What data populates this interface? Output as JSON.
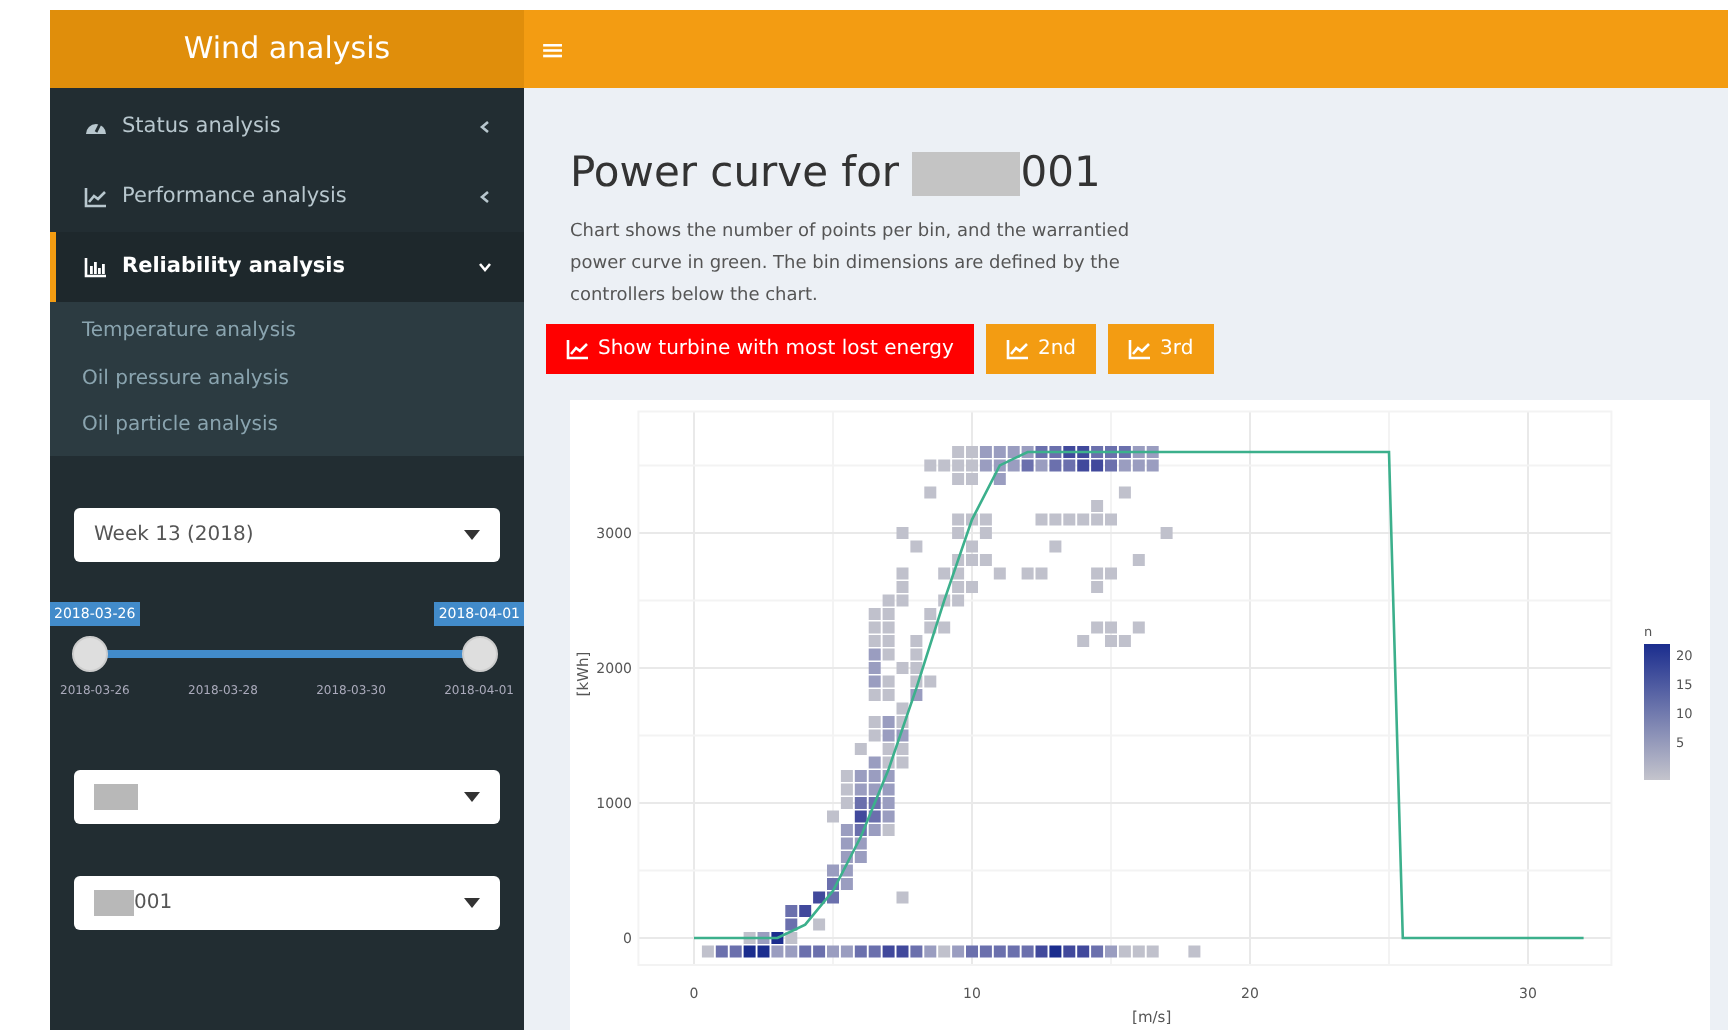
{
  "header": {
    "title": "Wind analysis",
    "menu_toggle": "≡"
  },
  "sidebar": {
    "items": [
      {
        "label": "Status analysis",
        "expanded": false,
        "selected": false
      },
      {
        "label": "Performance analysis",
        "expanded": false,
        "selected": false
      },
      {
        "label": "Reliability analysis",
        "expanded": true,
        "selected": true,
        "children": [
          {
            "label": "Temperature analysis"
          },
          {
            "label": "Oil pressure analysis"
          },
          {
            "label": "Oil particle analysis"
          }
        ]
      }
    ],
    "period_select": {
      "value": "Week 13 (2018)"
    },
    "date_slider": {
      "handles": [
        {
          "label": "2018-03-26"
        },
        {
          "label": "2018-04-01"
        }
      ],
      "ticks": [
        "2018-03-26",
        "2018-03-28",
        "2018-03-30",
        "2018-04-01"
      ]
    },
    "park_select": {
      "redacted": true
    },
    "turbine_select": {
      "redacted": true,
      "value": "001"
    }
  },
  "main": {
    "title": "Power curve for ",
    "title_redacted": true,
    "title_suffix": "001",
    "description": "Chart shows the number of points per bin, and the warrantied power curve in green. The bin dimensions are defined by the controllers below the chart.",
    "buttons": [
      {
        "label": "Show turbine with most lost energy",
        "kind": "primary"
      },
      {
        "label": "2nd",
        "kind": "secondary"
      },
      {
        "label": "3rd",
        "kind": "secondary"
      }
    ],
    "legend": {
      "title": "n",
      "ticks": [
        "20",
        "15",
        "10",
        "5"
      ]
    },
    "chart_data": {
      "type": "scatter",
      "xlabel": "[m/s]",
      "ylabel": "[kWh]",
      "xlim": [
        -2,
        33
      ],
      "ylim": [
        -200,
        3900
      ],
      "xticks": [
        0,
        10,
        20,
        30
      ],
      "yticks": [
        0,
        1000,
        2000,
        3000
      ],
      "grid": true,
      "series": [
        {
          "color": "#c0c1cc",
          "x": [
            0.5,
            9,
            15.5,
            16,
            16.5,
            18,
            2,
            3.5,
            4.5,
            7.5,
            7,
            5,
            5.5,
            5.5,
            5.5,
            7,
            7.5,
            6,
            7,
            7.5,
            6.5,
            6.5,
            7.5,
            7.5,
            6.5,
            7,
            7,
            8,
            8.5,
            7.5,
            8,
            7,
            8,
            6.5,
            7,
            8,
            14,
            15,
            15.5,
            6.5,
            7,
            8.5,
            9,
            14.5,
            15,
            16,
            6.5,
            7,
            8.5,
            7,
            7.5,
            9,
            9.5,
            7.5,
            9.5,
            10,
            14.5,
            7.5,
            9,
            9.5,
            11,
            12,
            12.5,
            14.5,
            15,
            9.5,
            10,
            10.5,
            16,
            8,
            10,
            13,
            7.5,
            9.5,
            10.5,
            17,
            9.5,
            10,
            10.5,
            12.5,
            13,
            13.5,
            14,
            14.5,
            15,
            14.5,
            8.5,
            15.5,
            9.5,
            10,
            8.5,
            9,
            9.5,
            10,
            9.5,
            10
          ],
          "values": [
            -100,
            -100,
            -100,
            -100,
            -100,
            -100,
            0,
            0,
            100,
            300,
            800,
            900,
            1000,
            1100,
            1200,
            1300,
            1300,
            1400,
            1400,
            1400,
            1500,
            1600,
            1600,
            1700,
            1800,
            1800,
            1900,
            1900,
            1900,
            2000,
            2000,
            2100,
            2100,
            2200,
            2200,
            2200,
            2200,
            2200,
            2200,
            2300,
            2300,
            2300,
            2300,
            2300,
            2300,
            2300,
            2400,
            2400,
            2400,
            2500,
            2500,
            2500,
            2500,
            2600,
            2600,
            2600,
            2600,
            2700,
            2700,
            2700,
            2700,
            2700,
            2700,
            2700,
            2700,
            2800,
            2800,
            2800,
            2800,
            2900,
            2900,
            2900,
            3000,
            3000,
            3000,
            3000,
            3100,
            3100,
            3100,
            3100,
            3100,
            3100,
            3100,
            3100,
            3100,
            3200,
            3300,
            3300,
            3400,
            3400,
            3500,
            3500,
            3500,
            3500,
            3600,
            3600
          ]
        },
        {
          "color": "#9a9dc0",
          "x": [
            3,
            3.5,
            5,
            5.5,
            8.5,
            9.5,
            15,
            2.5,
            5.5,
            5,
            5.5,
            5.5,
            6,
            5.5,
            6,
            5.5,
            6.5,
            7,
            7,
            6,
            6.5,
            7,
            6,
            6.5,
            7,
            6.5,
            7,
            7.5,
            7,
            8,
            6.5,
            6.5,
            6.5,
            11,
            10.5,
            11,
            11.5,
            12.5,
            15.5,
            16,
            16.5,
            10.5,
            11,
            11.5,
            12,
            16,
            16.5
          ],
          "values": [
            -100,
            -100,
            -100,
            -100,
            -100,
            -100,
            -100,
            0,
            400,
            500,
            500,
            600,
            600,
            700,
            700,
            800,
            800,
            900,
            1000,
            1100,
            1100,
            1100,
            1200,
            1200,
            1200,
            1300,
            1500,
            1500,
            1600,
            1800,
            1900,
            2000,
            2100,
            3400,
            3500,
            3500,
            3500,
            3500,
            3500,
            3500,
            3500,
            3600,
            3600,
            3600,
            3600,
            3600,
            3600
          ]
        },
        {
          "color": "#6b70ad",
          "x": [
            1,
            1.5,
            4,
            4.5,
            6,
            6.5,
            8,
            10,
            10.5,
            11,
            11.5,
            12,
            14.5,
            3.5,
            3.5,
            5,
            5,
            6,
            6.5,
            6,
            6.5,
            12,
            13,
            13.5,
            15,
            12.5,
            13,
            14.5,
            15,
            15.5
          ],
          "values": [
            -100,
            -100,
            -100,
            -100,
            -100,
            -100,
            -100,
            -100,
            -100,
            -100,
            -100,
            -100,
            -100,
            100,
            200,
            300,
            400,
            800,
            900,
            1000,
            1000,
            3500,
            3500,
            3500,
            3500,
            3600,
            3600,
            3600,
            3600,
            3600
          ]
        },
        {
          "color": "#41499c",
          "x": [
            7,
            7.5,
            12.5,
            13.5,
            14,
            4,
            4.5,
            6,
            14,
            14.5,
            13.5,
            14
          ],
          "values": [
            -100,
            -100,
            -100,
            -100,
            -100,
            200,
            300,
            900,
            3500,
            3500,
            3600,
            3600
          ]
        },
        {
          "color": "#1b2d8e",
          "x": [
            2,
            2.5,
            13,
            3
          ],
          "values": [
            -100,
            -100,
            -100,
            0
          ]
        },
        {
          "type": "line",
          "color": "#3cb08c",
          "x": [
            0,
            3,
            4,
            5,
            6,
            7,
            8,
            9,
            10,
            11,
            12,
            25,
            25.5,
            32
          ],
          "values": [
            0,
            0,
            100,
            350,
            750,
            1250,
            1850,
            2500,
            3100,
            3500,
            3600,
            3600,
            0,
            0
          ]
        }
      ]
    }
  }
}
